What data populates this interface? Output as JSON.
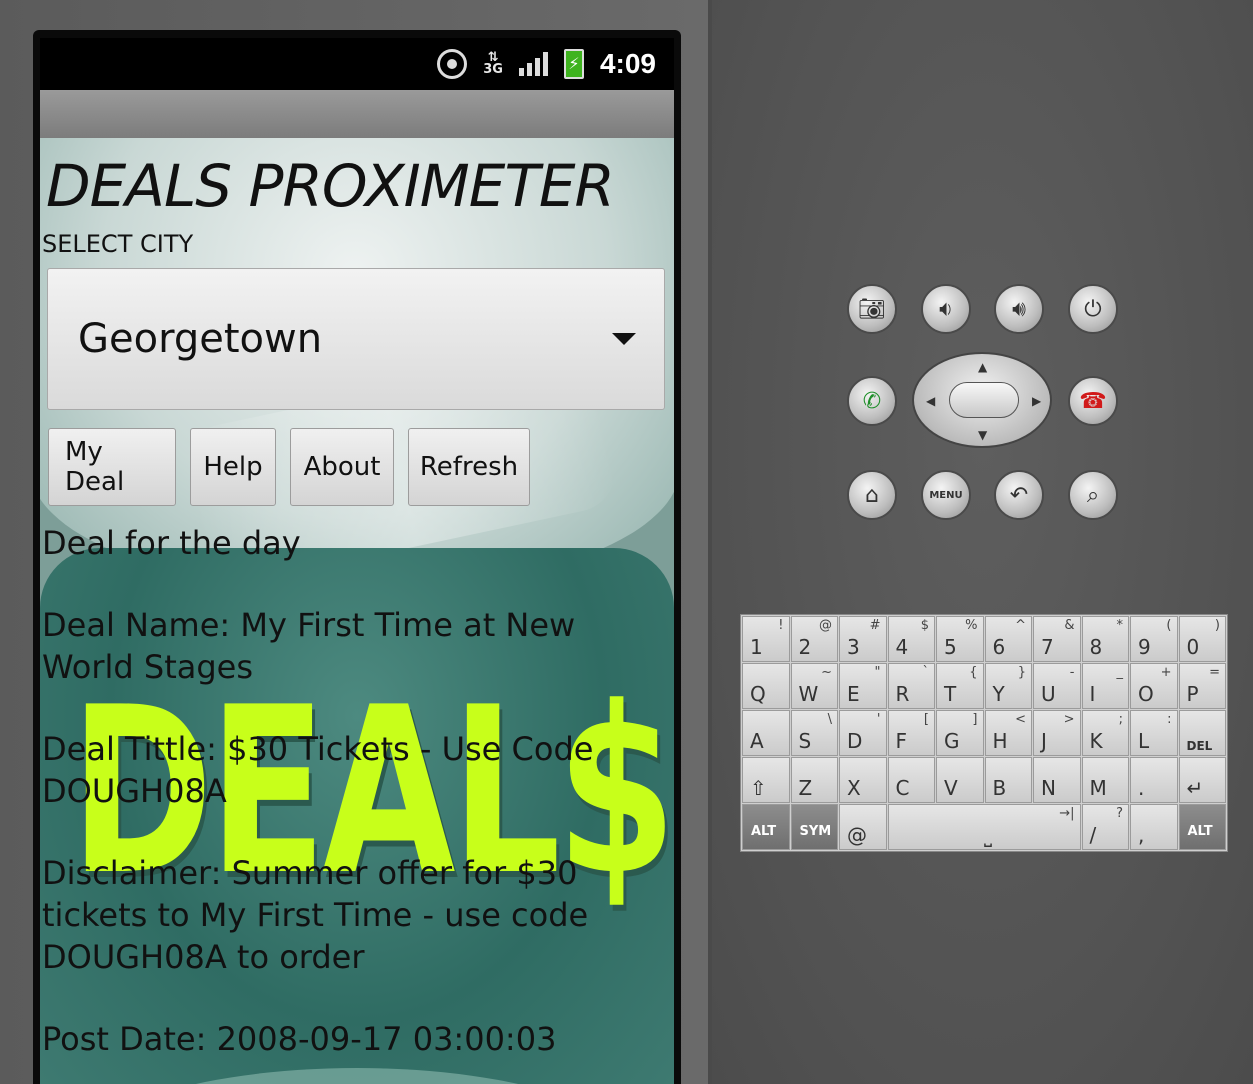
{
  "status_bar": {
    "time": "4:09",
    "network": "3G",
    "icons": [
      "gps-icon",
      "data-3g-icon",
      "signal-icon",
      "battery-charging-icon"
    ]
  },
  "app": {
    "title": "DEALS PROXIMETER",
    "select_label": "SELECT CITY",
    "city_selected": "Georgetown",
    "buttons": {
      "my_deal": "My Deal",
      "help": "Help",
      "about": "About",
      "refresh": "Refresh"
    },
    "deal": {
      "heading": "Deal for the day",
      "name": "Deal Name: My First Time at New World Stages",
      "title": "Deal Tittle: $30 Tickets - Use Code DOUGH08A",
      "disclaimer": "Disclaimer: Summer offer for $30 tickets to My First Time - use code DOUGH08A to order",
      "post_date": "Post Date: 2008-09-17 03:00:03"
    },
    "background_text": "DEAL$"
  },
  "emulator": {
    "hardware_buttons": [
      "camera-icon",
      "volume-down-icon",
      "volume-up-icon",
      "power-icon",
      "call-icon",
      "end-call-icon",
      "home-icon",
      "menu-button",
      "back-icon",
      "search-icon"
    ],
    "menu_label": "MENU",
    "keyboard": {
      "row1": [
        [
          "1",
          "!"
        ],
        [
          "2",
          "@"
        ],
        [
          "3",
          "#"
        ],
        [
          "4",
          "$"
        ],
        [
          "5",
          "%"
        ],
        [
          "6",
          "^"
        ],
        [
          "7",
          "&"
        ],
        [
          "8",
          "*"
        ],
        [
          "9",
          "("
        ],
        [
          "0",
          ")"
        ]
      ],
      "row2": [
        [
          "Q",
          ""
        ],
        [
          "W",
          "~"
        ],
        [
          "E",
          "\""
        ],
        [
          "R",
          "`"
        ],
        [
          "T",
          "{"
        ],
        [
          "Y",
          "}"
        ],
        [
          "U",
          "-"
        ],
        [
          "I",
          "_"
        ],
        [
          "O",
          "+"
        ],
        [
          "P",
          "="
        ]
      ],
      "row3": [
        [
          "A",
          ""
        ],
        [
          "S",
          "\\"
        ],
        [
          "D",
          "'"
        ],
        [
          "F",
          "["
        ],
        [
          "G",
          "]"
        ],
        [
          "H",
          "<"
        ],
        [
          "J",
          ">"
        ],
        [
          "K",
          ";"
        ],
        [
          "L",
          ":"
        ],
        [
          "DEL",
          ""
        ]
      ],
      "row4": [
        [
          "⇧",
          ""
        ],
        [
          "Z",
          ""
        ],
        [
          "X",
          ""
        ],
        [
          "C",
          ""
        ],
        [
          "V",
          ""
        ],
        [
          "B",
          ""
        ],
        [
          "N",
          ""
        ],
        [
          "M",
          ""
        ],
        [
          ".",
          ""
        ],
        [
          "↵",
          ""
        ]
      ],
      "row5_left": [
        "ALT",
        "SYM",
        "@"
      ],
      "row5_space": "⎵",
      "row5_right": [
        "/",
        ",",
        "ALT"
      ],
      "row5_alts": {
        "slash": "?",
        "tab": "→|"
      }
    }
  }
}
